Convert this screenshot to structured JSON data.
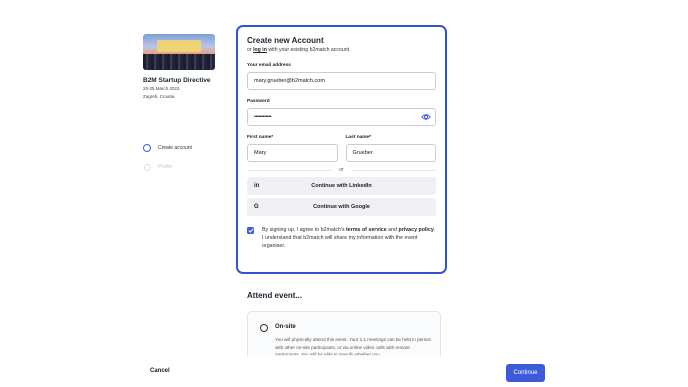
{
  "event": {
    "name": "B2M Startup Directive",
    "dates": "20-25 March 2023",
    "location": "Zagreb, Croatia"
  },
  "steps": [
    {
      "label": "Create account",
      "active": true
    },
    {
      "label": "Profile",
      "active": false
    }
  ],
  "form": {
    "title": "Create new Account",
    "subtitle_pre": "or ",
    "subtitle_link": "log in",
    "subtitle_post": " with your existing b2match account",
    "email_label": "Your email address",
    "email_value": "mary.grueber@b2match.com",
    "password_label": "Password",
    "password_value": "••••••••••••",
    "password_icon": "eye-icon",
    "first_name_label": "First name*",
    "first_name_value": "Mary",
    "last_name_label": "Last name*",
    "last_name_value": "Grueber",
    "or_text": "or",
    "linkedin_icon_text": "in",
    "linkedin_label": "Continue with LinkedIn",
    "google_icon_text": "G",
    "google_label": "Continue with Google",
    "terms_checked": true,
    "terms_pre": "By signing up, I agree to b2match's ",
    "terms_link": "terms of service",
    "terms_mid": " and ",
    "privacy_link": "privacy policy",
    "terms_post": ". I understand that b2match will share my information with the event organiser."
  },
  "attend": {
    "heading": "Attend event...",
    "option_title": "On-site",
    "option_desc": "You will physically attend this event. Your 1:1 meetings can be held in person with other on-site participants, or via online video calls with remote participants. You will be able to specify whether you"
  },
  "footer": {
    "cancel_label": "Cancel",
    "continue_label": "Continue"
  },
  "colors": {
    "accent": "#3d5bd9",
    "card_border": "#3552d3"
  }
}
